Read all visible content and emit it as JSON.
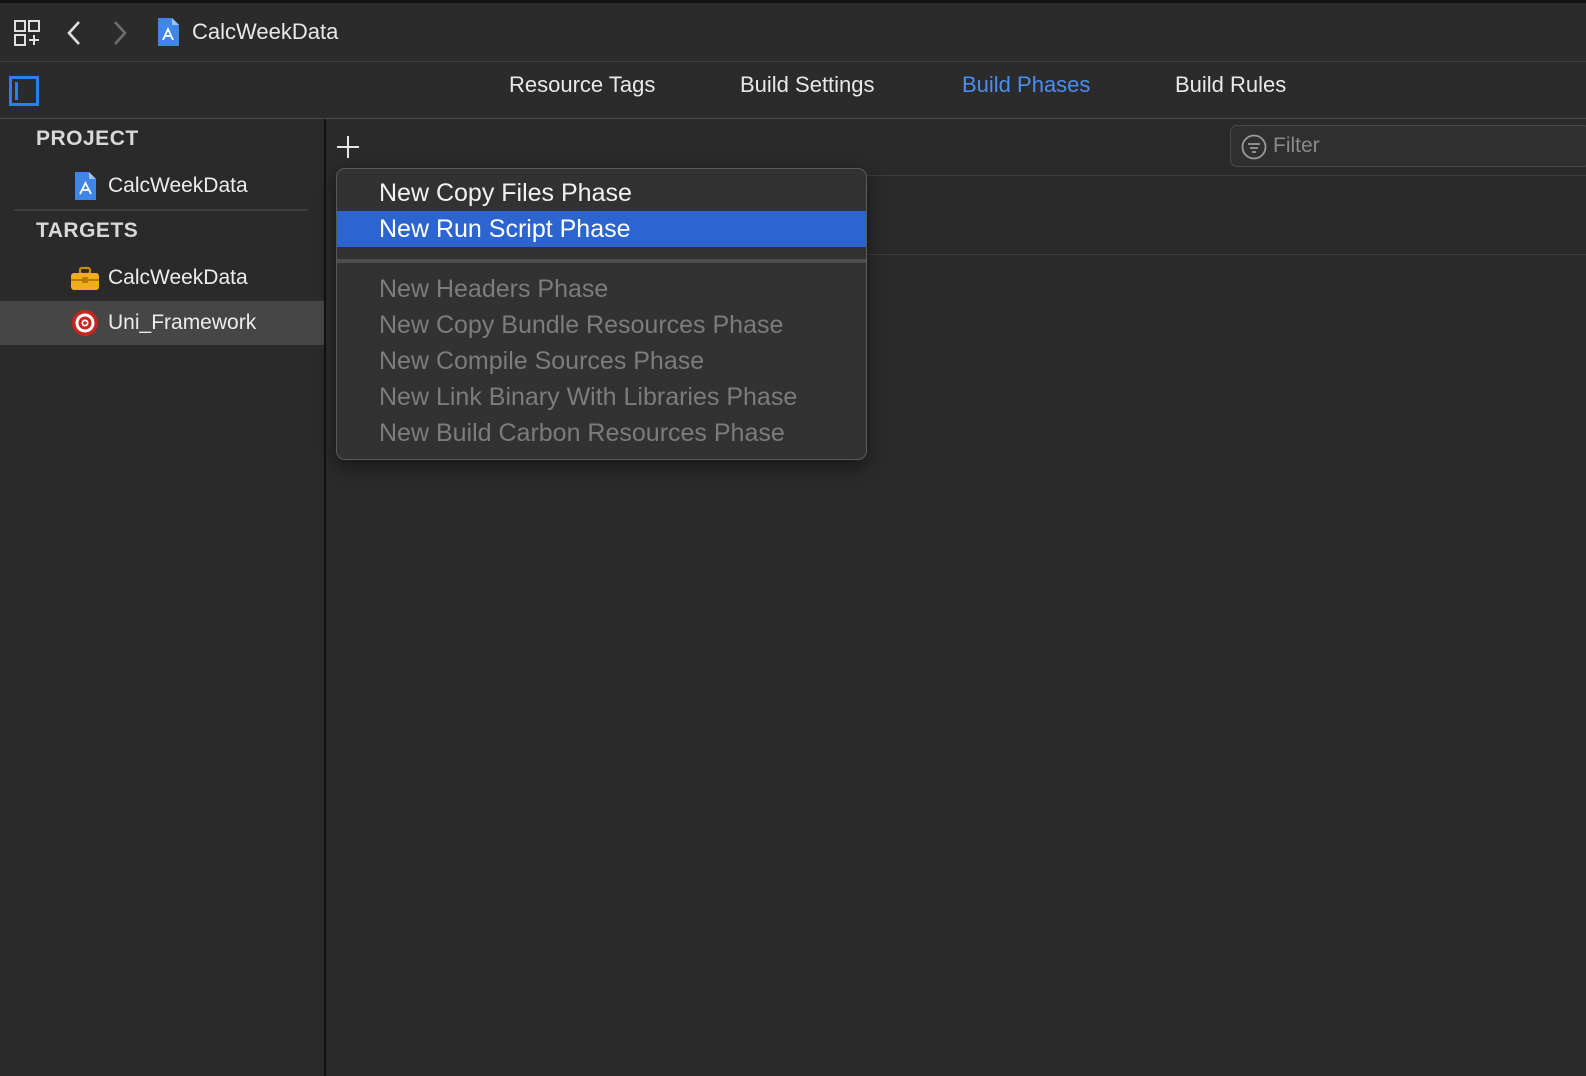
{
  "window": {
    "breadcrumb": "CalcWeekData"
  },
  "tabs": [
    {
      "label": "Resource Tags",
      "active": false
    },
    {
      "label": "Build Settings",
      "active": false
    },
    {
      "label": "Build Phases",
      "active": true
    },
    {
      "label": "Build Rules",
      "active": false
    }
  ],
  "sidebar": {
    "project_header": "PROJECT",
    "project_item": "CalcWeekData",
    "targets_header": "TARGETS",
    "targets": [
      {
        "label": "CalcWeekData",
        "icon": "toolbox-icon",
        "selected": false
      },
      {
        "label": "Uni_Framework",
        "icon": "target-icon",
        "selected": true
      }
    ]
  },
  "filter": {
    "placeholder": "Filter"
  },
  "menu": {
    "enabled_items": [
      "New Copy Files Phase",
      "New Run Script Phase"
    ],
    "highlighted": "New Run Script Phase",
    "disabled_items": [
      "New Headers Phase",
      "New Copy Bundle Resources Phase",
      "New Compile Sources Phase",
      "New Link Binary With Libraries Phase",
      "New Build Carbon Resources Phase"
    ]
  },
  "colors": {
    "accent": "#4c8df0",
    "highlight": "#2c64d0",
    "background": "#2a2a2a"
  }
}
